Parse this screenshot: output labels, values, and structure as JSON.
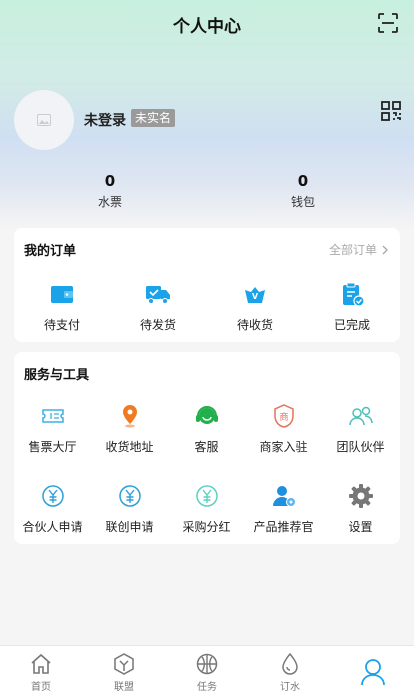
{
  "header": {
    "title": "个人中心"
  },
  "profile": {
    "login_text": "未登录",
    "badge": "未实名"
  },
  "stats": [
    {
      "value": "0",
      "label": "水票"
    },
    {
      "value": "0",
      "label": "钱包"
    }
  ],
  "orders": {
    "title": "我的订单",
    "all_label": "全部订单",
    "items": [
      {
        "label": "待支付",
        "icon": "wallet-icon"
      },
      {
        "label": "待发货",
        "icon": "truck-icon"
      },
      {
        "label": "待收货",
        "icon": "receive-icon"
      },
      {
        "label": "已完成",
        "icon": "clipboard-check-icon"
      }
    ]
  },
  "services": {
    "title": "服务与工具",
    "items": [
      {
        "label": "售票大厅",
        "icon": "ticket-icon"
      },
      {
        "label": "收货地址",
        "icon": "location-icon"
      },
      {
        "label": "客服",
        "icon": "headset-icon"
      },
      {
        "label": "商家入驻",
        "icon": "shop-icon"
      },
      {
        "label": "团队伙伴",
        "icon": "team-icon"
      },
      {
        "label": "合伙人申请",
        "icon": "yen-icon"
      },
      {
        "label": "联创申请",
        "icon": "yen-icon"
      },
      {
        "label": "采购分红",
        "icon": "yen-icon"
      },
      {
        "label": "产品推荐官",
        "icon": "user-badge-icon"
      },
      {
        "label": "设置",
        "icon": "gear-icon"
      }
    ]
  },
  "tabbar": [
    {
      "label": "首页",
      "icon": "home-icon"
    },
    {
      "label": "联盟",
      "icon": "cube-icon"
    },
    {
      "label": "任务",
      "icon": "globe-icon"
    },
    {
      "label": "订水",
      "icon": "water-drop-icon"
    },
    {
      "label": "",
      "icon": "user-icon"
    }
  ],
  "colors": {
    "accent": "#1aa3e8",
    "orange": "#f07a22",
    "green": "#22b04c",
    "inactive": "#888888"
  }
}
